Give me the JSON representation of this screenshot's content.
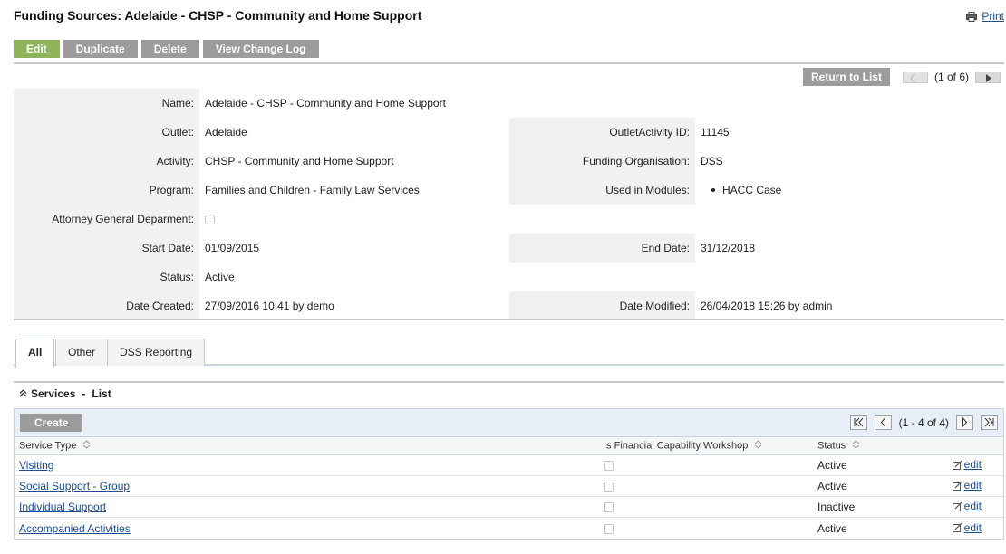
{
  "header": {
    "title": "Funding Sources: Adelaide - CHSP - Community and Home Support",
    "print_label": "Print"
  },
  "toolbar": {
    "edit_label": "Edit",
    "duplicate_label": "Duplicate",
    "delete_label": "Delete",
    "change_log_label": "View Change Log"
  },
  "record_nav": {
    "return_label": "Return to List",
    "position": "(1 of 6)"
  },
  "details": {
    "name_label": "Name:",
    "name_value": "Adelaide - CHSP - Community and Home Support",
    "outlet_label": "Outlet:",
    "outlet_value": "Adelaide",
    "outlet_activity_id_label": "OutletActivity ID:",
    "outlet_activity_id_value": "11145",
    "activity_label": "Activity:",
    "activity_value": "CHSP - Community and Home Support",
    "funding_org_label": "Funding Organisation:",
    "funding_org_value": "DSS",
    "program_label": "Program:",
    "program_value": "Families and Children - Family Law Services",
    "used_in_modules_label": "Used in Modules:",
    "used_in_modules": [
      "HACC Case"
    ],
    "attorney_label": "Attorney General Deparment:",
    "attorney_checked": false,
    "start_date_label": "Start Date:",
    "start_date_value": "01/09/2015",
    "end_date_label": "End Date:",
    "end_date_value": "31/12/2018",
    "status_label": "Status:",
    "status_value": "Active",
    "date_created_label": "Date Created:",
    "date_created_value": "27/09/2016 10:41 by demo",
    "date_modified_label": "Date Modified:",
    "date_modified_value": "26/04/2018 15:26 by admin"
  },
  "tabs": [
    {
      "label": "All",
      "active": true
    },
    {
      "label": "Other",
      "active": false
    },
    {
      "label": "DSS Reporting",
      "active": false
    }
  ],
  "services": {
    "title": "Services",
    "separator": "-",
    "subtitle": "List",
    "create_label": "Create",
    "pager_text": "(1 - 4 of 4)",
    "columns": {
      "service_type": "Service Type",
      "fin_workshop": "Is Financial Capability Workshop",
      "status": "Status"
    },
    "edit_label": "edit",
    "rows": [
      {
        "service_type": "Visiting",
        "fin_workshop": false,
        "status": "Active"
      },
      {
        "service_type": "Social Support - Group",
        "fin_workshop": false,
        "status": "Active"
      },
      {
        "service_type": "Individual Support",
        "fin_workshop": false,
        "status": "Inactive"
      },
      {
        "service_type": "Accompanied Activities",
        "fin_workshop": false,
        "status": "Active"
      }
    ]
  },
  "colors": {
    "edit_green": "#8db35b",
    "button_grey": "#9c9c9c",
    "link_blue": "#1a4d8f",
    "label_bg": "#f1f1f1"
  }
}
